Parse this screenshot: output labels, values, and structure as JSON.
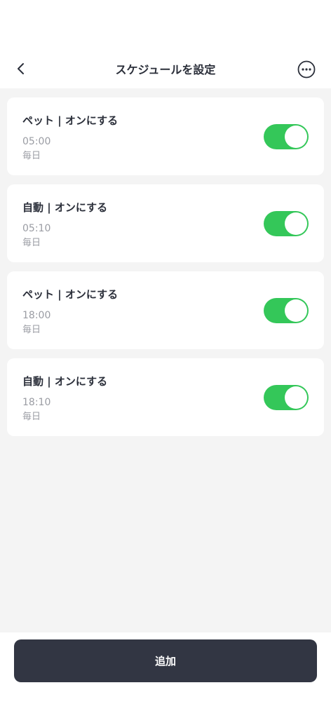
{
  "header": {
    "title": "スケジュールを設定",
    "back_icon": "chevron-left-icon",
    "more_icon": "more-horizontal-circle-icon"
  },
  "schedules": [
    {
      "title": "ペット | オンにする",
      "time": "05:00",
      "repeat": "毎日",
      "enabled": true
    },
    {
      "title": "自動 | オンにする",
      "time": "05:10",
      "repeat": "毎日",
      "enabled": true
    },
    {
      "title": "ペット | オンにする",
      "time": "18:00",
      "repeat": "毎日",
      "enabled": true
    },
    {
      "title": "自動 | オンにする",
      "time": "18:10",
      "repeat": "毎日",
      "enabled": true
    }
  ],
  "footer": {
    "add_label": "追加"
  },
  "colors": {
    "toggle_on": "#34c759",
    "primary_button": "#323643",
    "text_primary": "#2b2f3a",
    "text_secondary": "#9a9ca3",
    "background": "#f4f4f4"
  }
}
